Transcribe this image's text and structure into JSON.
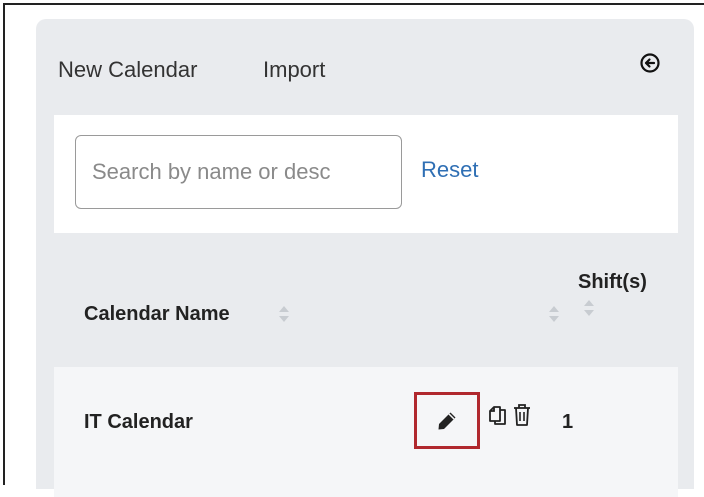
{
  "toolbar": {
    "new_calendar_label": "New Calendar",
    "import_label": "Import",
    "collapse_icon": "arrow-left-circle-icon"
  },
  "search": {
    "placeholder": "Search by name or desc",
    "value": "",
    "reset_label": "Reset"
  },
  "table": {
    "columns": [
      {
        "label": "Calendar Name",
        "sortable": true
      },
      {
        "label": "",
        "sortable": true
      },
      {
        "label": "Shift(s)",
        "sortable": true
      }
    ],
    "rows": [
      {
        "name": "IT Calendar",
        "actions": [
          "edit-pencil-icon",
          "copy-icon",
          "trash-icon"
        ],
        "shifts": "1"
      }
    ]
  },
  "colors": {
    "panel_bg": "#e9ebee",
    "link_blue": "#2f6fb4",
    "highlight_red": "#b0282e"
  }
}
